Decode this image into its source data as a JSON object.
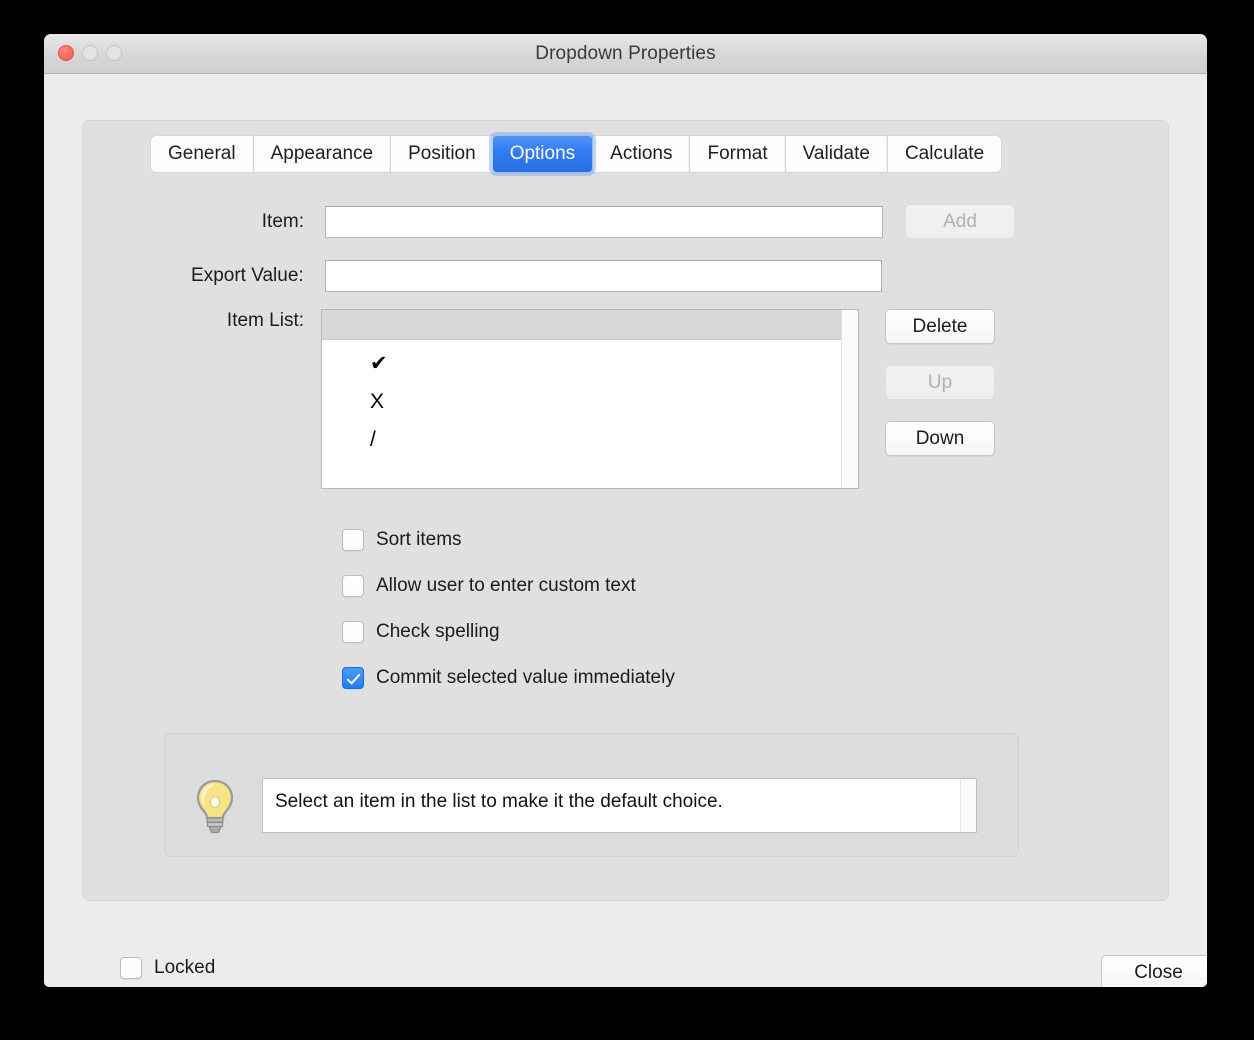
{
  "window": {
    "title": "Dropdown Properties",
    "traffic_lights": [
      "close-button",
      "minimize-button",
      "zoom-button"
    ]
  },
  "tabs": [
    {
      "label": "General",
      "selected": false
    },
    {
      "label": "Appearance",
      "selected": false
    },
    {
      "label": "Position",
      "selected": false
    },
    {
      "label": "Options",
      "selected": true
    },
    {
      "label": "Actions",
      "selected": false
    },
    {
      "label": "Format",
      "selected": false
    },
    {
      "label": "Validate",
      "selected": false
    },
    {
      "label": "Calculate",
      "selected": false
    }
  ],
  "options_tab": {
    "item_label": "Item:",
    "item_value": "",
    "item_placeholder": "",
    "export_value_label": "Export Value:",
    "export_value": "",
    "export_value_placeholder": "",
    "add_button": "Add",
    "add_button_enabled": false,
    "item_list_label": "Item List:",
    "item_list": [
      "✔",
      "X",
      "/"
    ],
    "list_buttons": [
      {
        "label": "Delete",
        "enabled": true
      },
      {
        "label": "Up",
        "enabled": false
      },
      {
        "label": "Down",
        "enabled": true
      }
    ],
    "checkboxes": [
      {
        "label": "Sort items",
        "checked": false
      },
      {
        "label": "Allow user to enter custom text",
        "checked": false
      },
      {
        "label": "Check spelling",
        "checked": false
      },
      {
        "label": "Commit selected value immediately",
        "checked": true
      }
    ],
    "hint": {
      "icon": "lightbulb-icon",
      "text": "Select an item in the list to make it the default choice."
    }
  },
  "footer": {
    "locked_label": "Locked",
    "locked_checked": false,
    "close_button": "Close"
  },
  "colors": {
    "accent": "#2f79f0",
    "window_background": "#ececec",
    "panel_background": "#e0e0e0",
    "titlebar": "#d8d8d8",
    "close_light": "#fb6a61",
    "bulb_yellow": "#f7e07a"
  }
}
